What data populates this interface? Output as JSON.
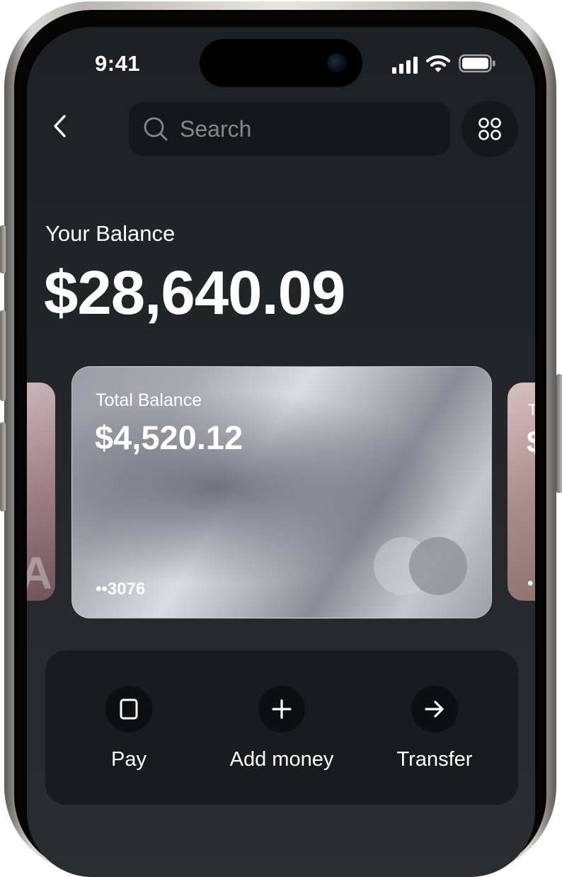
{
  "status_bar": {
    "time": "9:41",
    "signal_icon": "cellular-signal-icon",
    "wifi_icon": "wifi-icon",
    "battery_icon": "battery-icon"
  },
  "nav": {
    "back_icon": "chevron-left-icon",
    "search": {
      "placeholder": "Search",
      "value": "",
      "icon": "search-icon"
    },
    "menu_icon": "grid-dots-icon"
  },
  "balance": {
    "label": "Your Balance",
    "amount": "$28,640.09"
  },
  "cards": {
    "main": {
      "title": "Total Balance",
      "amount": "$4,520.12",
      "number": "••3076",
      "logo": "card-network-circles-icon"
    },
    "peek_left": {
      "partial_text": "A"
    },
    "peek_right": {
      "partial_title": "T",
      "partial_amount": "$",
      "partial_number": "•"
    }
  },
  "actions": [
    {
      "label": "Pay",
      "icon": "square-icon"
    },
    {
      "label": "Add money",
      "icon": "plus-icon"
    },
    {
      "label": "Transfer",
      "icon": "arrow-right-icon"
    }
  ],
  "colors": {
    "screen_bg": "#1f2023",
    "surface": "#16171a",
    "panel": "#1a1b1e",
    "text_primary": "#ffffff",
    "text_muted": "#85878d"
  }
}
